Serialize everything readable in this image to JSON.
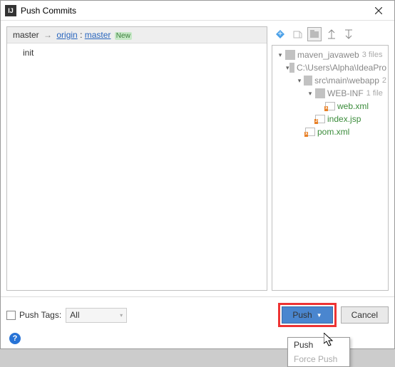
{
  "window": {
    "title": "Push Commits"
  },
  "branch": {
    "local": "master",
    "remote": "origin",
    "remote_branch": "master",
    "badge": "New"
  },
  "commits": [
    {
      "message": "init"
    }
  ],
  "tree": {
    "root": {
      "name": "maven_javaweb",
      "hint": "3 files",
      "path": {
        "name": "C:\\Users\\Alpha\\IdeaPro",
        "hint": "",
        "webapp": {
          "name": "src\\main\\webapp",
          "hint": "2",
          "webinf": {
            "name": "WEB-INF",
            "hint": "1 file",
            "files": [
              {
                "name": "web.xml",
                "badge": "XML"
              }
            ]
          },
          "files": [
            {
              "name": "index.jsp",
              "badge": "JSP"
            }
          ]
        },
        "files": [
          {
            "name": "pom.xml",
            "badge": "XML"
          }
        ]
      }
    }
  },
  "bottom": {
    "push_tags_label": "Push Tags:",
    "combo_value": "All"
  },
  "buttons": {
    "push": "Push",
    "cancel": "Cancel"
  },
  "dropdown": {
    "push": "Push",
    "force": "Force Push"
  }
}
